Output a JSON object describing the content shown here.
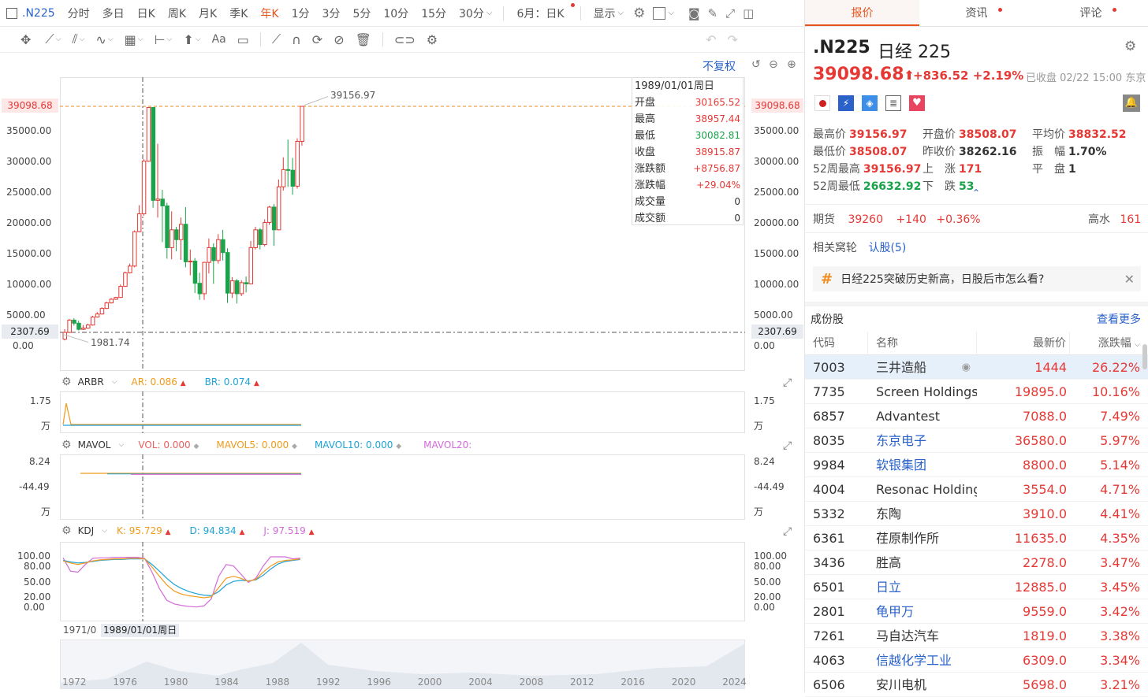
{
  "topbar": {
    "symbol": ".N225",
    "periods": [
      "分时",
      "多日",
      "日K",
      "周K",
      "月K",
      "季K",
      "年K",
      "1分",
      "3分",
      "5分",
      "10分",
      "15分",
      "30分"
    ],
    "selected_period": "年K",
    "mode": "6月：日K",
    "display": "显示"
  },
  "chart": {
    "restore_label": "不复权",
    "price_labels": [
      "35000.00",
      "30000.00",
      "25000.00",
      "20000.00",
      "15000.00",
      "10000.00",
      "5000.00",
      "0.00"
    ],
    "current_price_tag": "39098.68",
    "crosshair_price_tag": "2307.69",
    "high_label": "39156.97",
    "low_label": "1981.74",
    "crosshair_date": "1989/01/01周日",
    "x_axis_start": "1971/0",
    "years": [
      "1972",
      "1976",
      "1980",
      "1984",
      "1988",
      "1992",
      "1996",
      "2000",
      "2004",
      "2008",
      "2012",
      "2016",
      "2020",
      "2024"
    ]
  },
  "tooltip": {
    "date": "1989/01/01周日",
    "rows": [
      {
        "k": "开盘",
        "v": "30165.52",
        "c": "up"
      },
      {
        "k": "最高",
        "v": "38957.44",
        "c": "up"
      },
      {
        "k": "最低",
        "v": "30082.81",
        "c": "dn"
      },
      {
        "k": "收盘",
        "v": "38915.87",
        "c": "up"
      },
      {
        "k": "涨跌额",
        "v": "+8756.87",
        "c": "up"
      },
      {
        "k": "涨跌幅",
        "v": "+29.04%",
        "c": "up"
      },
      {
        "k": "成交量",
        "v": "0",
        "c": ""
      },
      {
        "k": "成交额",
        "v": "0",
        "c": ""
      }
    ]
  },
  "arbr": {
    "name": "ARBR",
    "ar": "AR: 0.086",
    "br": "BR: 0.074",
    "y1": "1.75",
    "y2": "万"
  },
  "mavol": {
    "name": "MAVOL",
    "vol": "VOL: 0.000",
    "m5": "MAVOL5: 0.000",
    "m10": "MAVOL10: 0.000",
    "m20": "MAVOL20:",
    "y1": "8.24",
    "y2": "-44.49",
    "y3": "万"
  },
  "kdj": {
    "name": "KDJ",
    "k": "K: 95.729",
    "d": "D: 94.834",
    "j": "J: 97.519",
    "ylabels": [
      "100.00",
      "80.00",
      "50.00",
      "20.00",
      "0.00"
    ]
  },
  "right": {
    "tabs": [
      "报价",
      "资讯",
      "评论"
    ],
    "symbol": ".N225",
    "name": "日经 225",
    "price": "39098.68",
    "arrow": "⬆",
    "change": "+836.52",
    "change_pct": "+2.19%",
    "status": "已收盘 02/22 15:00 东京",
    "stats": {
      "high_k": "最高价",
      "high_v": "39156.97",
      "open_k": "开盘价",
      "open_v": "38508.07",
      "avg_k": "平均价",
      "avg_v": "38832.52",
      "low_k": "最低价",
      "low_v": "38508.07",
      "prev_k": "昨收价",
      "prev_v": "38262.16",
      "amp_k": "振　幅",
      "amp_v": "1.70%",
      "w52h_k": "52周最高",
      "w52h_v": "39156.97",
      "up_k": "上　涨",
      "up_v": "171",
      "flat_k": "平　盘",
      "flat_v": "1",
      "w52l_k": "52周最低",
      "w52l_v": "26632.92",
      "down_k": "下　跌",
      "down_v": "53"
    },
    "futures": {
      "k": "期货",
      "price": "39260",
      "chg": "+140",
      "pct": "+0.36%",
      "tide_k": "高水",
      "tide_v": "161"
    },
    "warrants": {
      "k": "相关窝轮",
      "v": "认股(5)"
    },
    "news": "日经225突破历史新高，日股后市怎么看?",
    "constituents_title": "成份股",
    "more": "查看更多",
    "columns": [
      "代码",
      "名称",
      "最新价",
      "涨跌幅"
    ],
    "rows": [
      {
        "code": "7003",
        "name": "三井造船",
        "price": "1444",
        "pct": "26.22%",
        "link": false
      },
      {
        "code": "7735",
        "name": "Screen Holdings",
        "price": "19895.0",
        "pct": "10.16%",
        "link": false
      },
      {
        "code": "6857",
        "name": "Advantest",
        "price": "7088.0",
        "pct": "7.49%",
        "link": false
      },
      {
        "code": "8035",
        "name": "东京电子",
        "price": "36580.0",
        "pct": "5.97%",
        "link": true
      },
      {
        "code": "9984",
        "name": "软银集团",
        "price": "8800.0",
        "pct": "5.14%",
        "link": true
      },
      {
        "code": "4004",
        "name": "Resonac Holdings",
        "price": "3554.0",
        "pct": "4.71%",
        "link": false
      },
      {
        "code": "5332",
        "name": "东陶",
        "price": "3910.0",
        "pct": "4.41%",
        "link": false
      },
      {
        "code": "6361",
        "name": "荏原制作所",
        "price": "11635.0",
        "pct": "4.35%",
        "link": false
      },
      {
        "code": "3436",
        "name": "胜高",
        "price": "2278.0",
        "pct": "3.47%",
        "link": false
      },
      {
        "code": "6501",
        "name": "日立",
        "price": "12885.0",
        "pct": "3.45%",
        "link": true
      },
      {
        "code": "2801",
        "name": "龟甲万",
        "price": "9559.0",
        "pct": "3.42%",
        "link": true
      },
      {
        "code": "7261",
        "name": "马自达汽车",
        "price": "1819.0",
        "pct": "3.38%",
        "link": false
      },
      {
        "code": "4063",
        "name": "信越化学工业",
        "price": "6309.0",
        "pct": "3.34%",
        "link": true
      },
      {
        "code": "6506",
        "name": "安川电机",
        "price": "5698.0",
        "pct": "3.21%",
        "link": false
      }
    ]
  }
}
